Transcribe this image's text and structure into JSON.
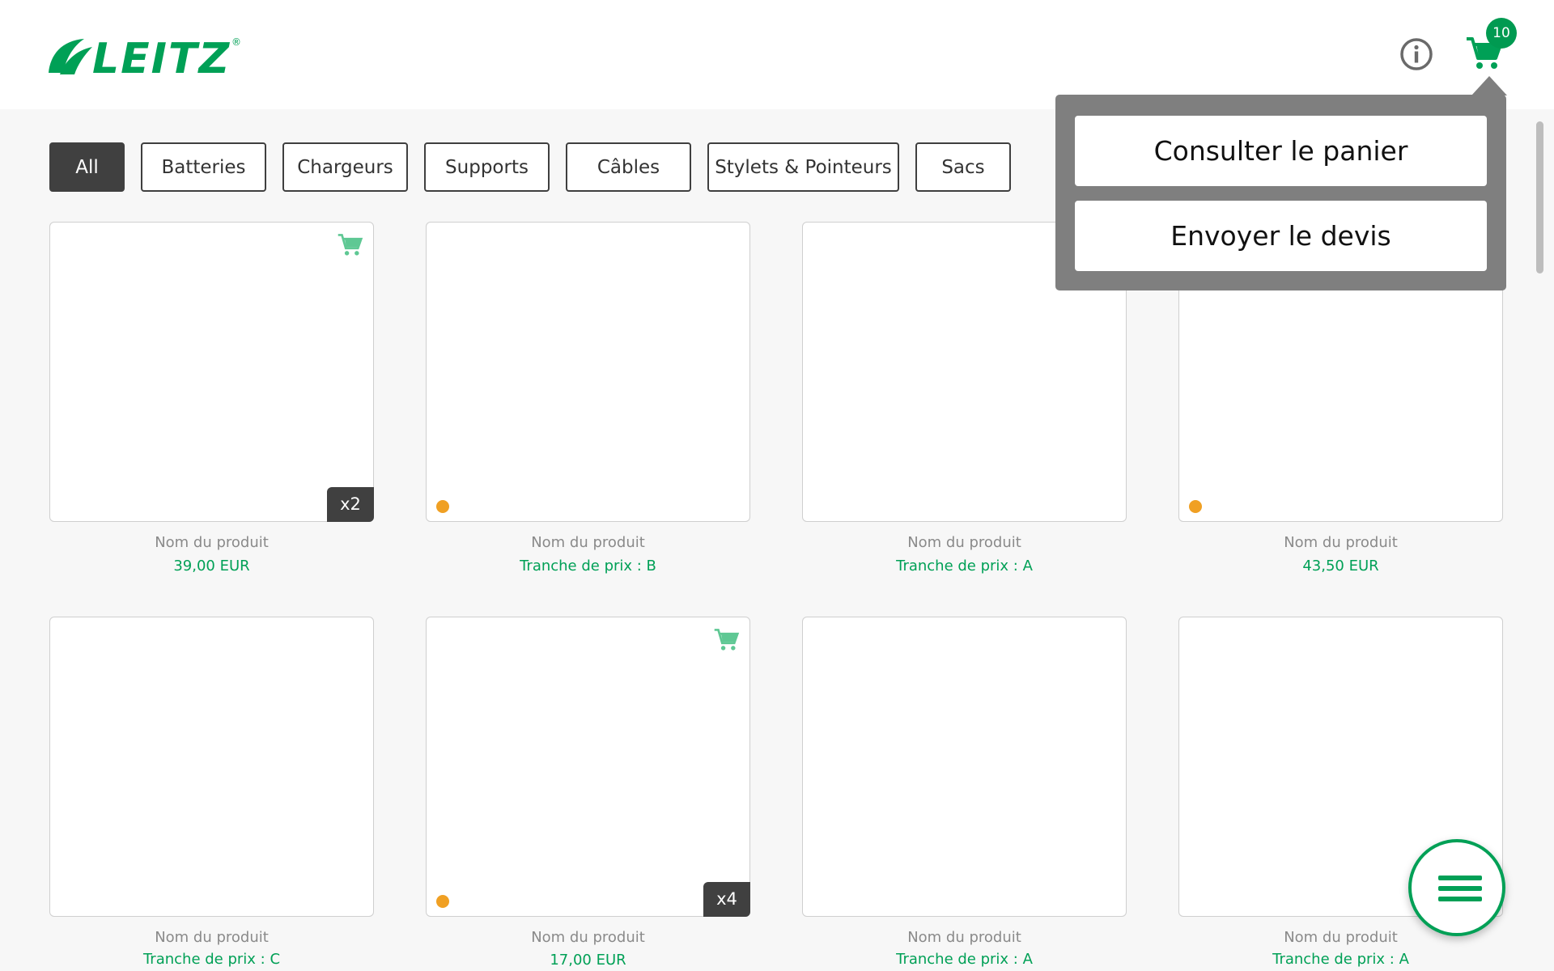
{
  "header": {
    "logo_text": "LEITZ",
    "cart_count": "10",
    "colors": {
      "brand_green": "#00a056",
      "badge_green": "#009a51",
      "dot_orange": "#f0a023"
    }
  },
  "filters": [
    {
      "label": "All",
      "active": true
    },
    {
      "label": "Batteries",
      "active": false
    },
    {
      "label": "Chargeurs",
      "active": false
    },
    {
      "label": "Supports",
      "active": false
    },
    {
      "label": "Câbles",
      "active": false
    },
    {
      "label": "Stylets & Pointeurs",
      "active": false
    },
    {
      "label": "Sacs",
      "active": false
    }
  ],
  "products": [
    {
      "name": "Nom du produit",
      "price": "39,00 EUR",
      "in_cart": true,
      "quantity": "x2",
      "dot": false
    },
    {
      "name": "Nom du produit",
      "price": "Tranche de prix : B",
      "in_cart": false,
      "quantity": "",
      "dot": true
    },
    {
      "name": "Nom du produit",
      "price": "Tranche de prix : A",
      "in_cart": false,
      "quantity": "",
      "dot": false
    },
    {
      "name": "Nom du produit",
      "price": "43,50 EUR",
      "in_cart": false,
      "quantity": "",
      "dot": true
    },
    {
      "name": "Nom du produit",
      "price": "Tranche de prix : C",
      "in_cart": false,
      "quantity": "",
      "dot": false
    },
    {
      "name": "Nom du produit",
      "price": "17,00 EUR",
      "in_cart": true,
      "quantity": "x4",
      "dot": true
    },
    {
      "name": "Nom du produit",
      "price": "Tranche de prix : A",
      "in_cart": false,
      "quantity": "",
      "dot": false
    },
    {
      "name": "Nom du produit",
      "price": "Tranche de prix : A",
      "in_cart": false,
      "quantity": "",
      "dot": false
    }
  ],
  "cart_menu": {
    "view_cart": "Consulter le panier",
    "send_quote": "Envoyer le devis"
  },
  "icons": {
    "info": "info-icon",
    "cart": "cart-icon",
    "menu": "hamburger-menu-icon"
  }
}
